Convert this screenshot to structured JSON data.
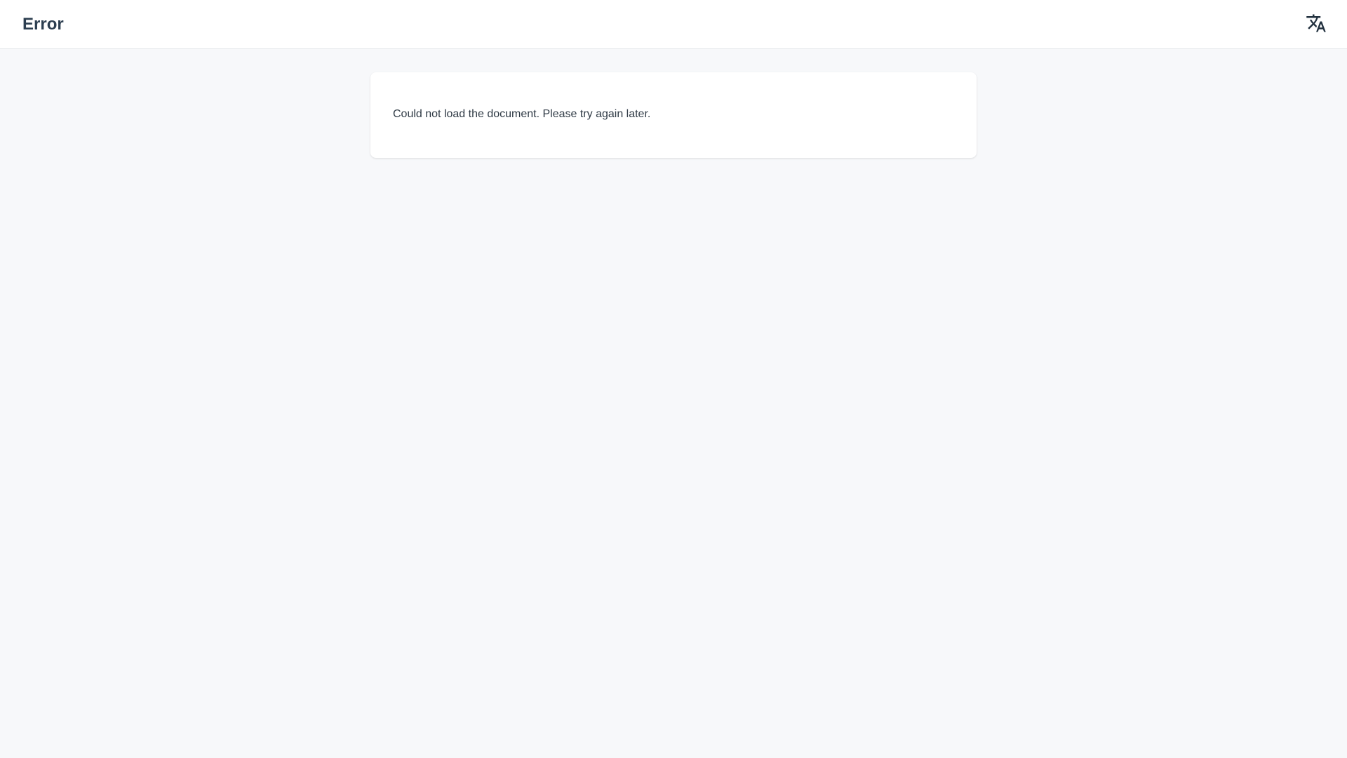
{
  "header": {
    "title": "Error",
    "translate_icon": "translate-icon"
  },
  "main": {
    "message": "Could not load the document. Please try again later."
  },
  "colors": {
    "background": "#f7f8fa",
    "surface": "#ffffff",
    "title": "#2c3e50",
    "text": "#2f3a45",
    "border": "#e3e6ea"
  }
}
